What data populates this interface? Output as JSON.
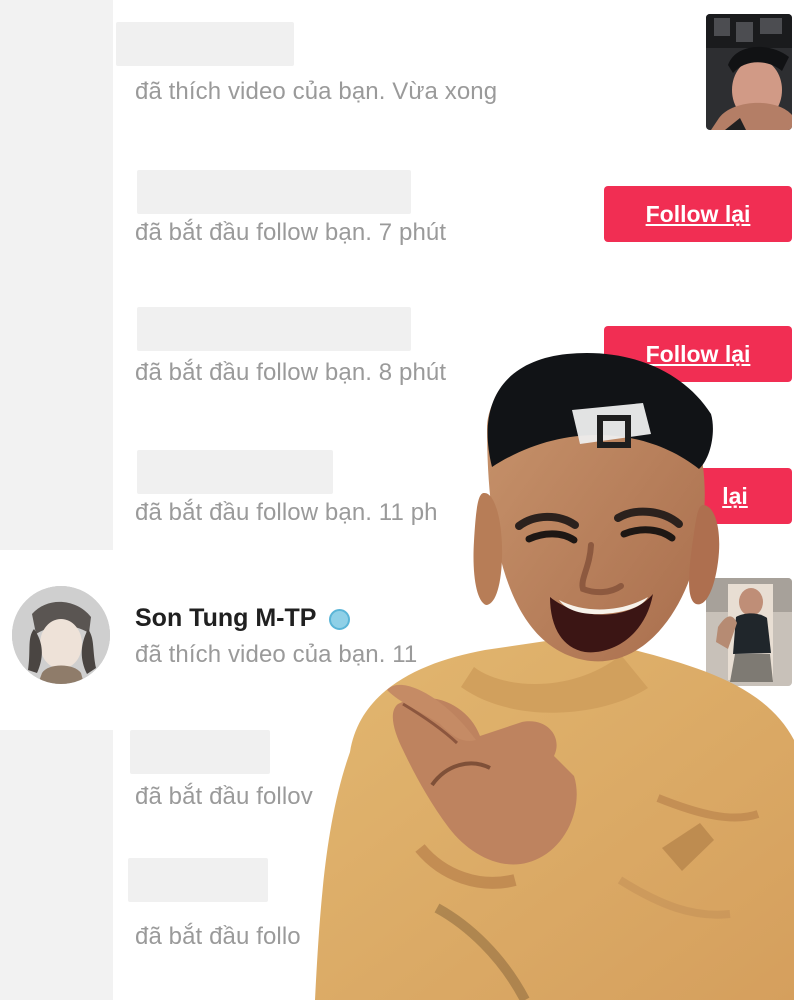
{
  "notifications": [
    {
      "activity": "đã thích video của bạn. Vừa xong"
    },
    {
      "activity": "đã bắt đầu follow bạn. 7 phút",
      "button_label": "Follow lại"
    },
    {
      "activity": "đã bắt đầu follow bạn. 8 phút",
      "button_label": "Follow lại"
    },
    {
      "activity": "đã bắt đầu follow bạn. 11 ph",
      "button_label": "lại"
    },
    {
      "user_name": "Son Tung M-TP",
      "activity": "đã thích video của bạn. 11",
      "verified_icon": "verified-badge-icon"
    },
    {
      "activity": "đã bắt đầu follov"
    },
    {
      "activity": "đã bắt đầu follo"
    }
  ],
  "colors": {
    "follow_button": "#f12e53",
    "secondary_text": "#9a9a9a",
    "name_text": "#202020",
    "verified_badge": "#8fd0e7"
  }
}
